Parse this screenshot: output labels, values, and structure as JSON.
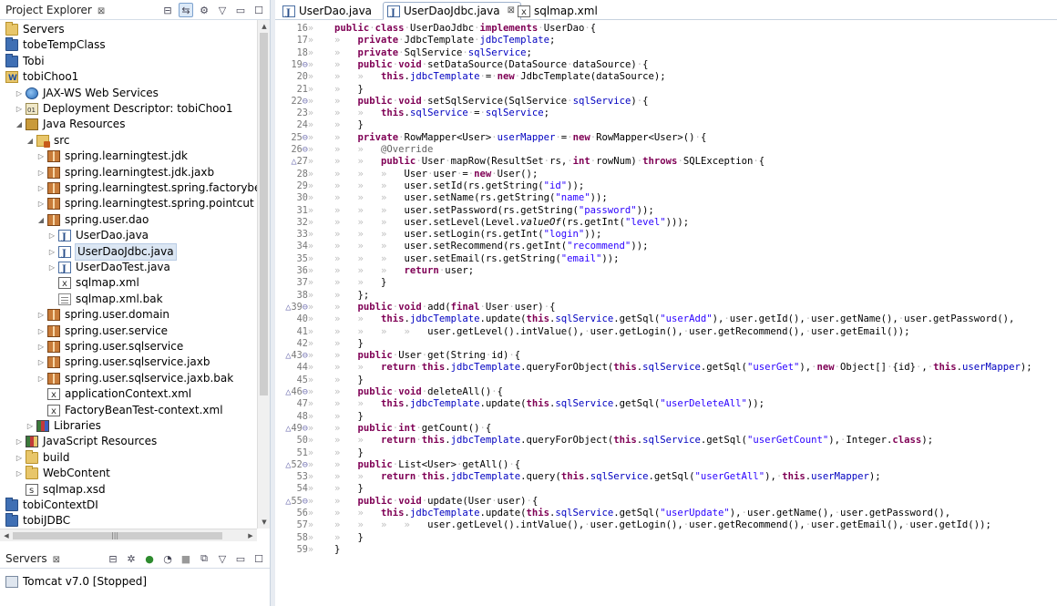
{
  "project_explorer": {
    "tab_title": "Project Explorer",
    "close_glyph": "⊠",
    "tree": [
      {
        "label": "Servers",
        "icon": "folder-icon",
        "depth": 0,
        "twisty": ""
      },
      {
        "label": "tobeTempClass",
        "icon": "project-icon",
        "depth": 0,
        "twisty": ""
      },
      {
        "label": "Tobi",
        "icon": "project-icon",
        "depth": 0,
        "twisty": ""
      },
      {
        "label": "tobiChoo1",
        "icon": "web-project-icon",
        "depth": 0,
        "twisty": ""
      },
      {
        "label": "JAX-WS Web Services",
        "icon": "web-services-icon",
        "depth": 1,
        "twisty": "closed"
      },
      {
        "label": "Deployment Descriptor: tobiChoo1",
        "icon": "deployment-descriptor-icon",
        "depth": 1,
        "twisty": "closed"
      },
      {
        "label": "Java Resources",
        "icon": "java-resources-icon",
        "depth": 1,
        "twisty": "open"
      },
      {
        "label": "src",
        "icon": "source-folder-icon",
        "depth": 2,
        "twisty": "open"
      },
      {
        "label": "spring.learningtest.jdk",
        "icon": "package-icon",
        "depth": 3,
        "twisty": "closed"
      },
      {
        "label": "spring.learningtest.jdk.jaxb",
        "icon": "package-icon",
        "depth": 3,
        "twisty": "closed"
      },
      {
        "label": "spring.learningtest.spring.factorybean",
        "icon": "package-icon",
        "depth": 3,
        "twisty": "closed"
      },
      {
        "label": "spring.learningtest.spring.pointcut",
        "icon": "package-icon",
        "depth": 3,
        "twisty": "closed"
      },
      {
        "label": "spring.user.dao",
        "icon": "package-icon",
        "depth": 3,
        "twisty": "open"
      },
      {
        "label": "UserDao.java",
        "icon": "java-file-icon",
        "depth": 4,
        "twisty": "closed"
      },
      {
        "label": "UserDaoJdbc.java",
        "icon": "java-file-icon",
        "depth": 4,
        "twisty": "closed",
        "selected": true
      },
      {
        "label": "UserDaoTest.java",
        "icon": "java-file-icon",
        "depth": 4,
        "twisty": "closed"
      },
      {
        "label": "sqlmap.xml",
        "icon": "xml-file-icon",
        "depth": 4,
        "twisty": ""
      },
      {
        "label": "sqlmap.xml.bak",
        "icon": "text-file-icon",
        "depth": 4,
        "twisty": ""
      },
      {
        "label": "spring.user.domain",
        "icon": "package-icon",
        "depth": 3,
        "twisty": "closed"
      },
      {
        "label": "spring.user.service",
        "icon": "package-icon",
        "depth": 3,
        "twisty": "closed"
      },
      {
        "label": "spring.user.sqlservice",
        "icon": "package-icon",
        "depth": 3,
        "twisty": "closed"
      },
      {
        "label": "spring.user.sqlservice.jaxb",
        "icon": "package-icon",
        "depth": 3,
        "twisty": "closed"
      },
      {
        "label": "spring.user.sqlservice.jaxb.bak",
        "icon": "package-icon",
        "depth": 3,
        "twisty": "closed"
      },
      {
        "label": "applicationContext.xml",
        "icon": "xml-file-icon",
        "depth": 3,
        "twisty": ""
      },
      {
        "label": "FactoryBeanTest-context.xml",
        "icon": "xml-file-icon",
        "depth": 3,
        "twisty": ""
      },
      {
        "label": "Libraries",
        "icon": "libraries-icon",
        "depth": 2,
        "twisty": "closed"
      },
      {
        "label": "JavaScript Resources",
        "icon": "javascript-resources-icon",
        "depth": 1,
        "twisty": "closed"
      },
      {
        "label": "build",
        "icon": "folder-icon",
        "depth": 1,
        "twisty": "closed"
      },
      {
        "label": "WebContent",
        "icon": "folder-icon",
        "depth": 1,
        "twisty": "closed"
      },
      {
        "label": "sqlmap.xsd",
        "icon": "xsd-file-icon",
        "depth": 1,
        "twisty": ""
      },
      {
        "label": "tobiContextDI",
        "icon": "project-icon",
        "depth": 0,
        "twisty": ""
      },
      {
        "label": "tobiJDBC",
        "icon": "project-icon",
        "depth": 0,
        "twisty": ""
      }
    ]
  },
  "servers_view": {
    "tab_title": "Servers",
    "close_glyph": "⊠",
    "items": [
      {
        "label": "Tomcat v7.0  [Stopped]",
        "icon": "tomcat-server-icon"
      }
    ]
  },
  "editor": {
    "tabs": [
      {
        "label": "UserDao.java",
        "icon": "java-file-icon",
        "active": false
      },
      {
        "label": "UserDaoJdbc.java",
        "icon": "java-file-icon",
        "active": true,
        "close_glyph": "⊠"
      },
      {
        "label": "sqlmap.xml",
        "icon": "xml-file-icon",
        "active": false
      }
    ],
    "lines": [
      {
        "n": "16",
        "m": "",
        "code": "public class UserDaoJdbc implements UserDao {"
      },
      {
        "n": "17",
        "m": "",
        "code": "    private JdbcTemplate jdbcTemplate;"
      },
      {
        "n": "18",
        "m": "",
        "code": "    private SqlService sqlService;"
      },
      {
        "n": "19",
        "m": "⊖",
        "code": "    public void setDataSource(DataSource dataSource) {"
      },
      {
        "n": "20",
        "m": "",
        "code": "        this.jdbcTemplate = new JdbcTemplate(dataSource);"
      },
      {
        "n": "21",
        "m": "",
        "code": "    }"
      },
      {
        "n": "22",
        "m": "⊖",
        "code": "    public void setSqlService(SqlService sqlService) {"
      },
      {
        "n": "23",
        "m": "",
        "code": "        this.sqlService = sqlService;"
      },
      {
        "n": "24",
        "m": "",
        "code": "    }"
      },
      {
        "n": "25",
        "m": "⊖",
        "code": "    private RowMapper<User> userMapper = new RowMapper<User>() {"
      },
      {
        "n": "26",
        "m": "⊖",
        "code": "        @Override"
      },
      {
        "n": "27",
        "m": "",
        "code": "        public User mapRow(ResultSet rs, int rowNum) throws SQLException {",
        "pre": "△"
      },
      {
        "n": "28",
        "m": "",
        "code": "            User user = new User();"
      },
      {
        "n": "29",
        "m": "",
        "code": "            user.setId(rs.getString(\"id\"));"
      },
      {
        "n": "30",
        "m": "",
        "code": "            user.setName(rs.getString(\"name\"));"
      },
      {
        "n": "31",
        "m": "",
        "code": "            user.setPassword(rs.getString(\"password\"));"
      },
      {
        "n": "32",
        "m": "",
        "code": "            user.setLevel(Level.valueOf(rs.getInt(\"level\")));"
      },
      {
        "n": "33",
        "m": "",
        "code": "            user.setLogin(rs.getInt(\"login\"));"
      },
      {
        "n": "34",
        "m": "",
        "code": "            user.setRecommend(rs.getInt(\"recommend\"));"
      },
      {
        "n": "35",
        "m": "",
        "code": "            user.setEmail(rs.getString(\"email\"));"
      },
      {
        "n": "36",
        "m": "",
        "code": "            return user;"
      },
      {
        "n": "37",
        "m": "",
        "code": "        }"
      },
      {
        "n": "38",
        "m": "",
        "code": "    };"
      },
      {
        "n": "39",
        "m": "⊖",
        "code": "    public void add(final User user) {",
        "pre": "△"
      },
      {
        "n": "40",
        "m": "",
        "code": "        this.jdbcTemplate.update(this.sqlService.getSql(\"userAdd\"), user.getId(), user.getName(), user.getPassword(),"
      },
      {
        "n": "41",
        "m": "",
        "code": "                user.getLevel().intValue(), user.getLogin(), user.getRecommend(), user.getEmail());"
      },
      {
        "n": "42",
        "m": "",
        "code": "    }"
      },
      {
        "n": "43",
        "m": "⊖",
        "code": "    public User get(String id) {",
        "pre": "△"
      },
      {
        "n": "44",
        "m": "",
        "code": "        return this.jdbcTemplate.queryForObject(this.sqlService.getSql(\"userGet\"), new Object[] {id} , this.userMapper);"
      },
      {
        "n": "45",
        "m": "",
        "code": "    }"
      },
      {
        "n": "46",
        "m": "⊖",
        "code": "    public void deleteAll() {",
        "pre": "△"
      },
      {
        "n": "47",
        "m": "",
        "code": "        this.jdbcTemplate.update(this.sqlService.getSql(\"userDeleteAll\"));"
      },
      {
        "n": "48",
        "m": "",
        "code": "    }"
      },
      {
        "n": "49",
        "m": "⊖",
        "code": "    public int getCount() {",
        "pre": "△"
      },
      {
        "n": "50",
        "m": "",
        "code": "        return this.jdbcTemplate.queryForObject(this.sqlService.getSql(\"userGetCount\"), Integer.class);"
      },
      {
        "n": "51",
        "m": "",
        "code": "    }"
      },
      {
        "n": "52",
        "m": "⊖",
        "code": "    public List<User> getAll() {",
        "pre": "△"
      },
      {
        "n": "53",
        "m": "",
        "code": "        return this.jdbcTemplate.query(this.sqlService.getSql(\"userGetAll\"), this.userMapper);"
      },
      {
        "n": "54",
        "m": "",
        "code": "    }"
      },
      {
        "n": "55",
        "m": "⊖",
        "code": "    public void update(User user) {",
        "pre": "△"
      },
      {
        "n": "56",
        "m": "",
        "code": "        this.jdbcTemplate.update(this.sqlService.getSql(\"userUpdate\"), user.getName(), user.getPassword(),"
      },
      {
        "n": "57",
        "m": "",
        "code": "                user.getLevel().intValue(), user.getLogin(), user.getRecommend(), user.getEmail(), user.getId());"
      },
      {
        "n": "58",
        "m": "",
        "code": "    }"
      },
      {
        "n": "59",
        "m": "",
        "code": "}"
      }
    ]
  },
  "colors": {
    "keyword": "#7f0055",
    "field": "#0000c0",
    "string": "#2a00ff",
    "annotation": "#646464",
    "line_number": "#787878"
  }
}
